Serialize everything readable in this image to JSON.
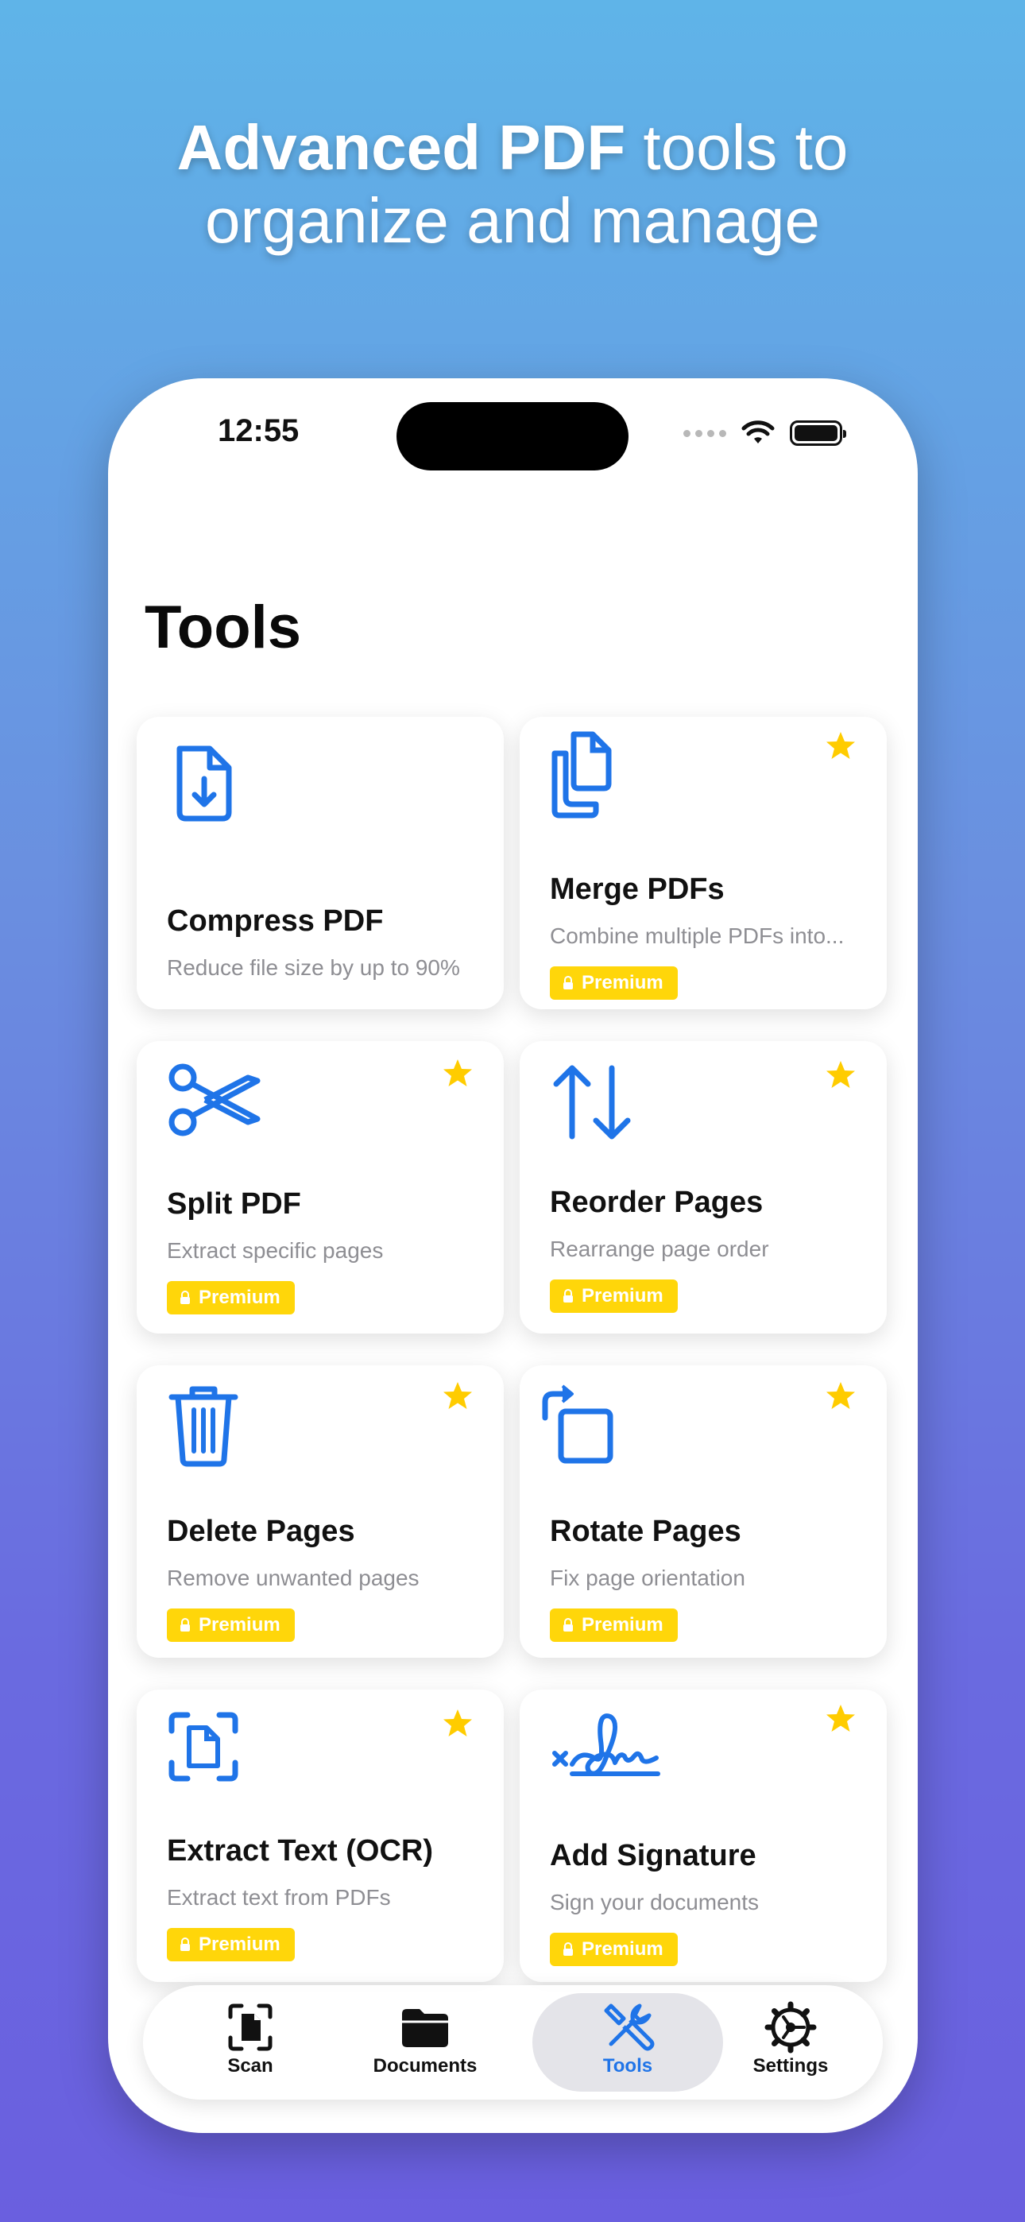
{
  "headline": {
    "bold": "Advanced PDF",
    "rest_line1": " tools to",
    "line2": "organize and manage"
  },
  "status": {
    "time": "12:55"
  },
  "page_title": "Tools",
  "tools": [
    {
      "name": "Compress PDF",
      "desc": "Reduce file size by up to 90%",
      "premium": false,
      "icon": "compress-icon"
    },
    {
      "name": "Merge PDFs",
      "desc": "Combine multiple PDFs into...",
      "premium": true,
      "icon": "merge-icon"
    },
    {
      "name": "Split PDF",
      "desc": "Extract specific pages",
      "premium": true,
      "icon": "scissors-icon"
    },
    {
      "name": "Reorder Pages",
      "desc": "Rearrange page order",
      "premium": true,
      "icon": "reorder-icon"
    },
    {
      "name": "Delete Pages",
      "desc": "Remove unwanted pages",
      "premium": true,
      "icon": "trash-icon"
    },
    {
      "name": "Rotate Pages",
      "desc": "Fix page orientation",
      "premium": true,
      "icon": "rotate-icon"
    },
    {
      "name": "Extract Text (OCR)",
      "desc": "Extract text from PDFs",
      "premium": true,
      "icon": "ocr-icon"
    },
    {
      "name": "Add Signature",
      "desc": "Sign your documents",
      "premium": true,
      "icon": "signature-icon"
    }
  ],
  "badge_label": "Premium",
  "tabbar": {
    "items": [
      {
        "label": "Scan",
        "icon": "scan-icon"
      },
      {
        "label": "Documents",
        "icon": "folder-icon"
      },
      {
        "label": "Tools",
        "icon": "tools-icon",
        "active": true
      },
      {
        "label": "Settings",
        "icon": "gear-icon"
      }
    ]
  },
  "colors": {
    "accent": "#1f74e8",
    "premium": "#ffd60a",
    "star": "#ffcc00"
  }
}
